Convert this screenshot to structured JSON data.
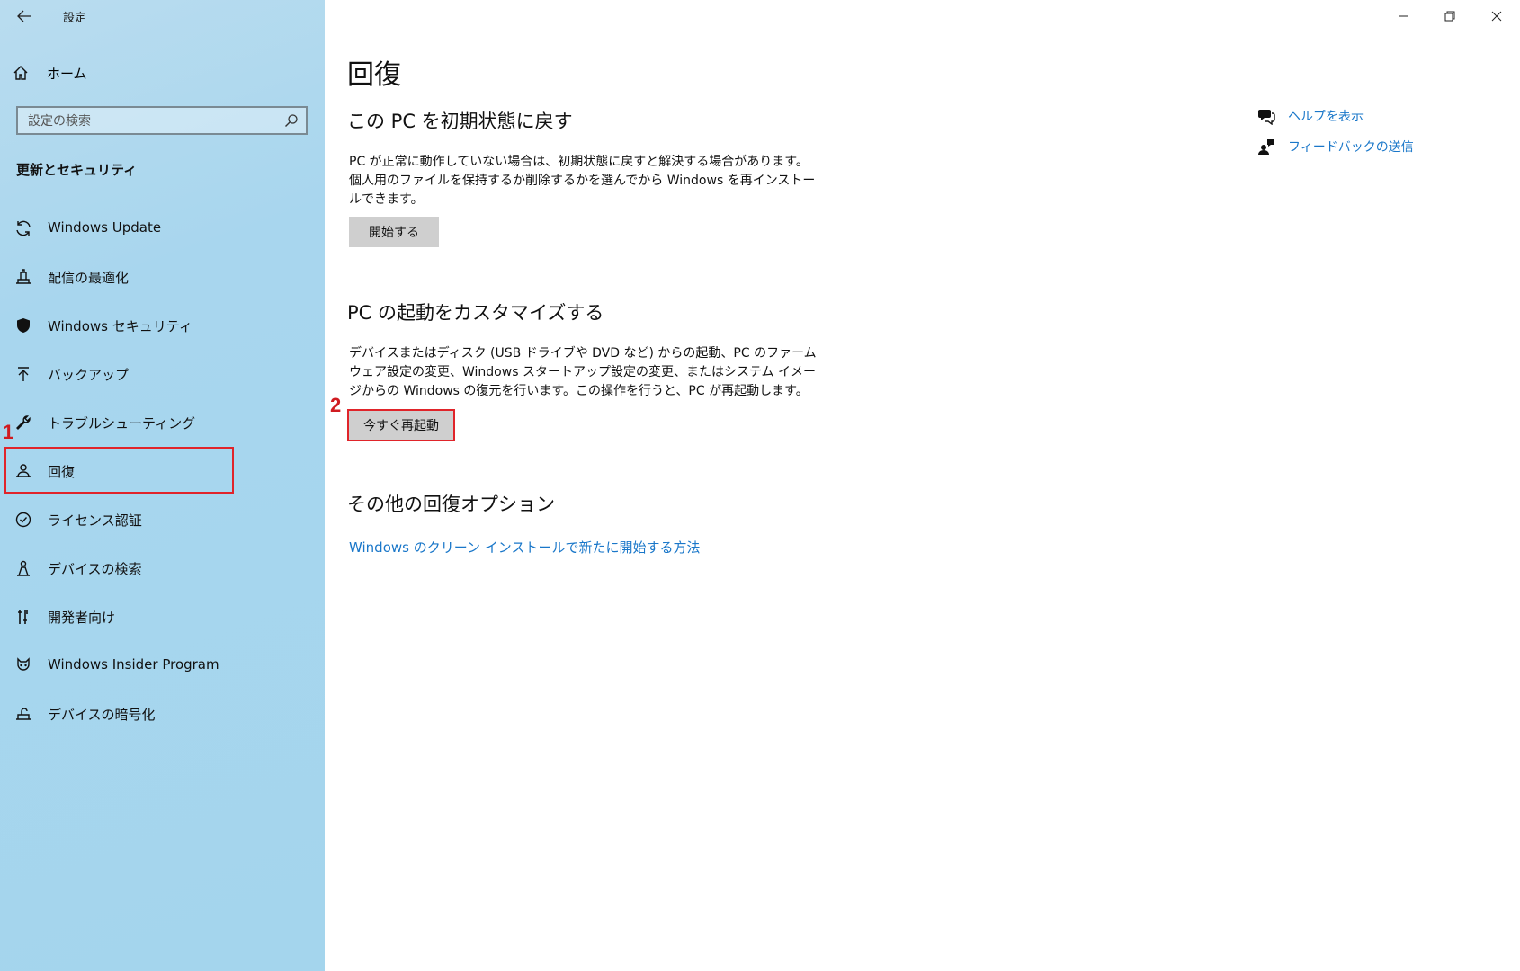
{
  "window": {
    "title": "設定",
    "minimize_icon": "minimize-icon",
    "restore_icon": "restore-icon",
    "close_icon": "close-icon"
  },
  "sidebar": {
    "home_label": "ホーム",
    "search_placeholder": "設定の検索",
    "section_title": "更新とセキュリティ",
    "items": [
      {
        "label": "Windows Update",
        "icon": "sync-icon"
      },
      {
        "label": "配信の最適化",
        "icon": "delivery-optimization-icon"
      },
      {
        "label": "Windows セキュリティ",
        "icon": "shield-icon"
      },
      {
        "label": "バックアップ",
        "icon": "backup-icon"
      },
      {
        "label": "トラブルシューティング",
        "icon": "wrench-icon"
      },
      {
        "label": "回復",
        "icon": "recovery-icon",
        "selected": true
      },
      {
        "label": "ライセンス認証",
        "icon": "check-circle-icon"
      },
      {
        "label": "デバイスの検索",
        "icon": "find-device-icon"
      },
      {
        "label": "開発者向け",
        "icon": "developer-icon"
      },
      {
        "label": "Windows Insider Program",
        "icon": "insider-icon"
      },
      {
        "label": "デバイスの暗号化",
        "icon": "encryption-icon"
      }
    ]
  },
  "annotations": {
    "step1": "1",
    "step2": "2",
    "highlight_color": "#e0242a"
  },
  "main": {
    "page_title": "回復",
    "reset": {
      "heading": "この PC を初期状態に戻す",
      "description": "PC が正常に動作していない場合は、初期状態に戻すと解決する場合があります。個人用のファイルを保持するか削除するかを選んでから Windows を再インストールできます。",
      "button": "開始する"
    },
    "startup": {
      "heading": "PC の起動をカスタマイズする",
      "description": "デバイスまたはディスク (USB ドライブや DVD など) からの起動、PC のファームウェア設定の変更、Windows スタートアップ設定の変更、またはシステム イメージからの Windows の復元を行います。この操作を行うと、PC が再起動します。",
      "button": "今すぐ再起動"
    },
    "other": {
      "heading": "その他の回復オプション",
      "link": "Windows のクリーン インストールで新たに開始する方法"
    },
    "help_links": [
      {
        "label": "ヘルプを表示",
        "icon": "help-chat-icon"
      },
      {
        "label": "フィードバックの送信",
        "icon": "feedback-icon"
      }
    ]
  },
  "colors": {
    "sidebar_bg": "#a8d6ee",
    "link": "#1a77c9",
    "button_bg": "#cfcfcf"
  }
}
